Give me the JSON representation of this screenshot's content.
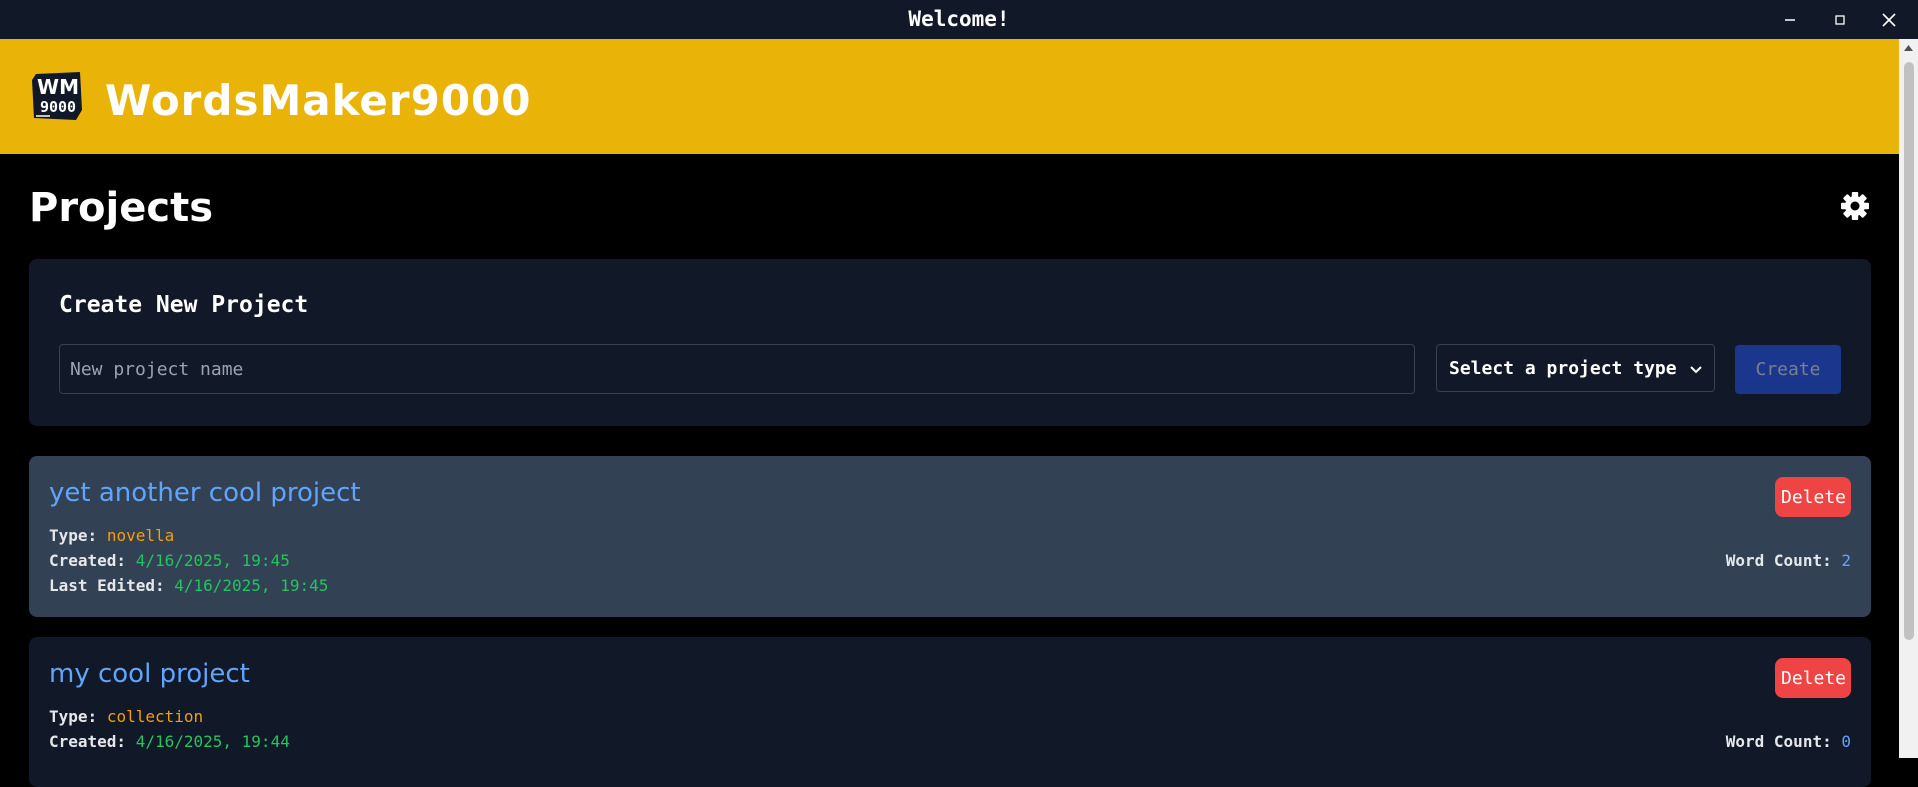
{
  "window": {
    "title": "Welcome!",
    "controls": [
      "minimize-icon",
      "maximize-icon",
      "close-icon"
    ]
  },
  "header": {
    "logo_text": "WM9000",
    "app_name": "WordsMaker9000",
    "accent_color": "#eab308"
  },
  "page": {
    "title": "Projects",
    "settings_icon": "gear-icon"
  },
  "create": {
    "title": "Create New Project",
    "name_placeholder": "New project name",
    "name_value": "",
    "type_selected": "Select a project type",
    "create_label": "Create"
  },
  "projects": [
    {
      "title": "yet another cool project",
      "type_label": "Type:",
      "type": "novella",
      "created_label": "Created:",
      "created": "4/16/2025, 19:45",
      "edited_label": "Last Edited:",
      "edited": "4/16/2025, 19:45",
      "wordcount_label": "Word Count:",
      "wordcount": "2",
      "delete_label": "Delete"
    },
    {
      "title": "my cool project",
      "type_label": "Type:",
      "type": "collection",
      "created_label": "Created:",
      "created": "4/16/2025, 19:44",
      "wordcount_label": "Word Count:",
      "wordcount": "0",
      "delete_label": "Delete"
    }
  ],
  "colors": {
    "title_link": "#60a5fa",
    "type_text": "#f59e0b",
    "date_text": "#22c55e",
    "delete_button": "#ef4444",
    "create_button": "#1e40af"
  }
}
